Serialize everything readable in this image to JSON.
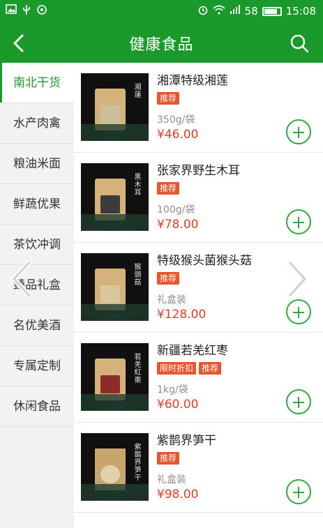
{
  "status_bar": {
    "signal_label": "58",
    "time": "15:08",
    "icons": [
      "image-icon",
      "usb-icon",
      "settings-icon",
      "alarm-icon",
      "wifi-icon",
      "signal-icon",
      "battery-icon"
    ]
  },
  "app_bar": {
    "title": "健康食品"
  },
  "sidebar": {
    "items": [
      {
        "label": "南北干货",
        "active": true
      },
      {
        "label": "水产肉禽"
      },
      {
        "label": "粮油米面"
      },
      {
        "label": "鲜蔬优果"
      },
      {
        "label": "茶饮冲调"
      },
      {
        "label": "臻品礼盒"
      },
      {
        "label": "名优美酒"
      },
      {
        "label": "专属定制"
      },
      {
        "label": "休闲食品"
      }
    ]
  },
  "products": [
    {
      "name": "湘潭特级湘莲",
      "tags": [
        "推荐"
      ],
      "spec": "350g/袋",
      "price": "¥46.00",
      "calligraphy": "湘蓮"
    },
    {
      "name": "张家界野生木耳",
      "tags": [
        "推荐"
      ],
      "spec": "100g/袋",
      "price": "¥78.00",
      "calligraphy": "黑木耳"
    },
    {
      "name": "特级猴头菌猴头菇",
      "tags": [
        "推荐"
      ],
      "spec": "礼盒装",
      "price": "¥128.00",
      "calligraphy": "猴頭菇"
    },
    {
      "name": "新疆若羌红枣",
      "tags": [
        "限时折扣",
        "推荐"
      ],
      "spec": "1kg/袋",
      "price": "¥60.00",
      "calligraphy": "若羌紅棗"
    },
    {
      "name": "紫鹊界笋干",
      "tags": [
        "推荐"
      ],
      "spec": "礼盒装",
      "price": "¥98.00",
      "calligraphy": "紫鵲界笋干"
    }
  ],
  "colors": {
    "brand_green": "#1a9a2a",
    "price_red": "#e53b2a",
    "tag_orange": "#e9542a"
  }
}
